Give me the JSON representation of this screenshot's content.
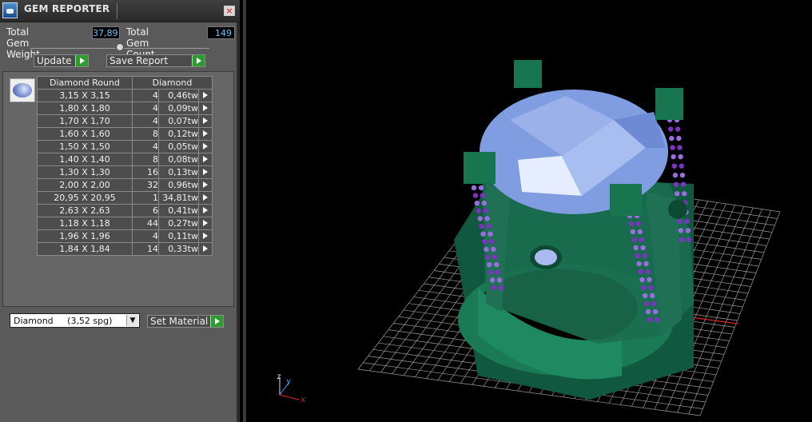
{
  "window": {
    "title": "GEM REPORTER"
  },
  "stats": {
    "total_weight_label": "Total Gem Weight",
    "total_weight_value": "37,89",
    "total_count_label": "Total Gem Count",
    "total_count_value": "149"
  },
  "buttons": {
    "update": "Update",
    "save_report": "Save Report",
    "set_material": "Set Material"
  },
  "table": {
    "headers": [
      "Diamond Round",
      "Diamond"
    ],
    "rows": [
      {
        "size": "3,15 X 3,15",
        "count": "4",
        "weight": "0,46tw"
      },
      {
        "size": "1,80 X 1,80",
        "count": "4",
        "weight": "0,09tw"
      },
      {
        "size": "1,70 X 1,70",
        "count": "4",
        "weight": "0,07tw"
      },
      {
        "size": "1,60 X 1,60",
        "count": "8",
        "weight": "0,12tw"
      },
      {
        "size": "1,50 X 1,50",
        "count": "4",
        "weight": "0,05tw"
      },
      {
        "size": "1,40 X 1,40",
        "count": "8",
        "weight": "0,08tw"
      },
      {
        "size": "1,30 X 1,30",
        "count": "16",
        "weight": "0,13tw"
      },
      {
        "size": "2,00 X 2,00",
        "count": "32",
        "weight": "0,96tw"
      },
      {
        "size": "20,95 X 20,95",
        "count": "1",
        "weight": "34,81tw"
      },
      {
        "size": "2,63 X 2,63",
        "count": "6",
        "weight": "0,41tw"
      },
      {
        "size": "1,18 X 1,18",
        "count": "44",
        "weight": "0,27tw"
      },
      {
        "size": "1,96 X 1,96",
        "count": "4",
        "weight": "0,11tw"
      },
      {
        "size": "1,84 X 1,84",
        "count": "14",
        "weight": "0,33tw"
      }
    ]
  },
  "material": {
    "selected": "Diamond     (3,52 spg)"
  },
  "viewport": {
    "axis_z": "z",
    "axis_y": "y",
    "axis_x": "x"
  },
  "colors": {
    "panel_bg": "#5a5a5a",
    "play_green": "#2e9b2e",
    "value_cyan": "#68c6ff",
    "metal": "#1f7a5a",
    "gem": "#8fa8e8",
    "accent_stones": "#8a2bbf"
  }
}
